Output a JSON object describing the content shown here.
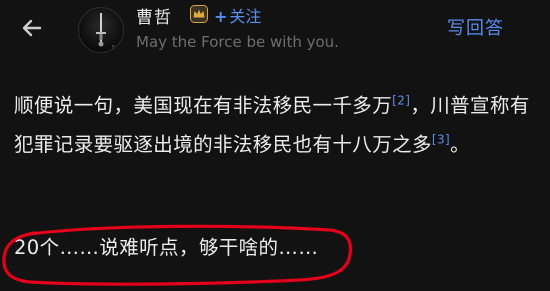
{
  "header": {
    "author_name": "曹哲",
    "follow_label": "关注",
    "follow_plus": "+",
    "motto": "May the Force be with you.",
    "write_answer": "写回答"
  },
  "content": {
    "p1_a": "顺便说一句，美国现在有非法移民一千多万",
    "ref1_num": "2",
    "p1_b": "，川普宣称有犯罪记录要驱逐出境的非法移民也有十八万之多",
    "ref2_num": "3",
    "p1_c": "。",
    "p2": "20个……说难听点，够干啥的……"
  },
  "colors": {
    "background": "#121212",
    "accent_blue": "#5b8def",
    "text": "#ececec",
    "muted": "#6e6e6e",
    "annotation_red": "#e2001a"
  },
  "icons": {
    "back": "back-arrow-icon",
    "badge": "crown-badge-icon"
  }
}
